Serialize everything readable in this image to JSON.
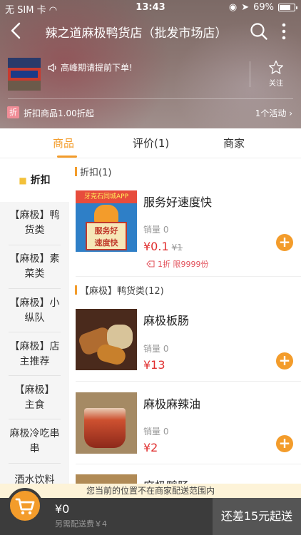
{
  "status_bar": {
    "carrier": "无 SIM 卡",
    "time": "13:43",
    "battery": "69%"
  },
  "nav": {
    "title": "辣之道麻极鸭货店（批发市场店）"
  },
  "shop": {
    "notice": "高峰期请提前下单!",
    "follow_label": "关注",
    "discount_icon": "折",
    "discount_text": "折扣商品1.00折起",
    "activity_text": "1个活动"
  },
  "tabs": [
    {
      "label": "商品"
    },
    {
      "label": "评价(1)"
    },
    {
      "label": "商家"
    }
  ],
  "sidebar": {
    "items": [
      {
        "label": "折扣"
      },
      {
        "label": "【麻极】鸭货类"
      },
      {
        "label": "【麻极】素菜类"
      },
      {
        "label": "【麻极】小纵队"
      },
      {
        "label": "【麻极】店主推荐"
      },
      {
        "label": "【麻极】主食"
      },
      {
        "label": "麻极冷吃串串"
      },
      {
        "label": "酒水饮料"
      }
    ]
  },
  "sections": [
    {
      "title": "折扣(1)"
    },
    {
      "title": "【麻极】鸭货类(12)"
    }
  ],
  "products": [
    {
      "name": "服务好速度快",
      "sales": "销量 0",
      "price": "¥0.1",
      "old_price": "¥1",
      "promo": "1折 限9999份",
      "image_tag": "牙克石同城APP",
      "image_board_line1": "服务好",
      "image_board_line2": "速度快"
    },
    {
      "name": "麻极板肠",
      "sales": "销量 0",
      "price": "¥13"
    },
    {
      "name": "麻极麻辣油",
      "sales": "销量 0",
      "price": "¥2"
    },
    {
      "name": "麻极鸭肠"
    }
  ],
  "bottom": {
    "notice": "您当前的位置不在商家配送范围内",
    "total": "¥0",
    "delivery_fee": "另需配送费￥4",
    "checkout": "还差15元起送"
  },
  "colors": {
    "accent": "#f39c2b",
    "price": "#e02f2f",
    "promo": "#e2505a"
  }
}
